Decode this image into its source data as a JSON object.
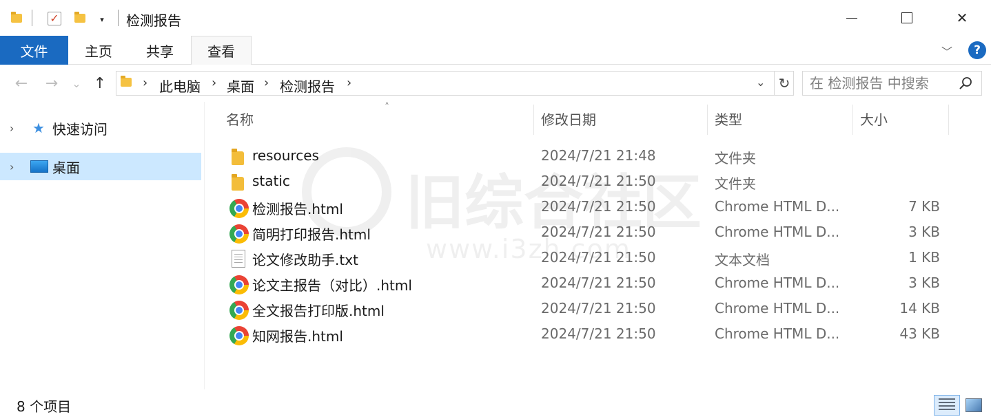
{
  "window": {
    "title": "检测报告",
    "minimize_label": "",
    "close_glyph": "✕"
  },
  "quick_access": {
    "dropdown_glyph": "▾",
    "check_glyph": "✓"
  },
  "ribbon": {
    "tabs": [
      {
        "label": "文件"
      },
      {
        "label": "主页"
      },
      {
        "label": "共享"
      },
      {
        "label": "查看"
      }
    ],
    "expand_glyph": "﹀",
    "help_glyph": "?"
  },
  "navigation": {
    "back_glyph": "←",
    "forward_glyph": "→",
    "recent_glyph": "⌄",
    "up_glyph": "↑"
  },
  "address": {
    "crumbs": [
      "此电脑",
      "桌面",
      "检测报告"
    ],
    "sep_glyph": "›",
    "dropdown_glyph": "⌄",
    "refresh_glyph": "↻"
  },
  "search": {
    "placeholder": "在 检测报告 中搜索"
  },
  "nav_pane": {
    "items": [
      {
        "label": "快速访问",
        "icon": "star-icon",
        "chevron": "›"
      },
      {
        "label": "桌面",
        "icon": "desktop-icon",
        "chevron": "›",
        "selected": true
      }
    ],
    "star_glyph": "★"
  },
  "columns": {
    "name": "名称",
    "date": "修改日期",
    "type": "类型",
    "size": "大小",
    "sort_glyph": "˄"
  },
  "files": [
    {
      "name": "resources",
      "date": "2024/7/21 21:48",
      "type": "文件夹",
      "size": "",
      "icon": "folder-icon"
    },
    {
      "name": "static",
      "date": "2024/7/21 21:50",
      "type": "文件夹",
      "size": "",
      "icon": "folder-icon"
    },
    {
      "name": "检测报告.html",
      "date": "2024/7/21 21:50",
      "type": "Chrome HTML D...",
      "size": "7 KB",
      "icon": "chrome-icon"
    },
    {
      "name": "简明打印报告.html",
      "date": "2024/7/21 21:50",
      "type": "Chrome HTML D...",
      "size": "3 KB",
      "icon": "chrome-icon"
    },
    {
      "name": "论文修改助手.txt",
      "date": "2024/7/21 21:50",
      "type": "文本文档",
      "size": "1 KB",
      "icon": "text-file-icon"
    },
    {
      "name": "论文主报告（对比）.html",
      "date": "2024/7/21 21:50",
      "type": "Chrome HTML D...",
      "size": "3 KB",
      "icon": "chrome-icon"
    },
    {
      "name": "全文报告打印版.html",
      "date": "2024/7/21 21:50",
      "type": "Chrome HTML D...",
      "size": "14 KB",
      "icon": "chrome-icon"
    },
    {
      "name": "知网报告.html",
      "date": "2024/7/21 21:50",
      "type": "Chrome HTML D...",
      "size": "43 KB",
      "icon": "chrome-icon"
    }
  ],
  "watermark": {
    "text": "旧综合社区",
    "url": "www.i3zh.com"
  },
  "status": {
    "item_count": "8 个项目"
  },
  "colors": {
    "accent": "#1a6ac1",
    "selection": "#cce8ff"
  }
}
